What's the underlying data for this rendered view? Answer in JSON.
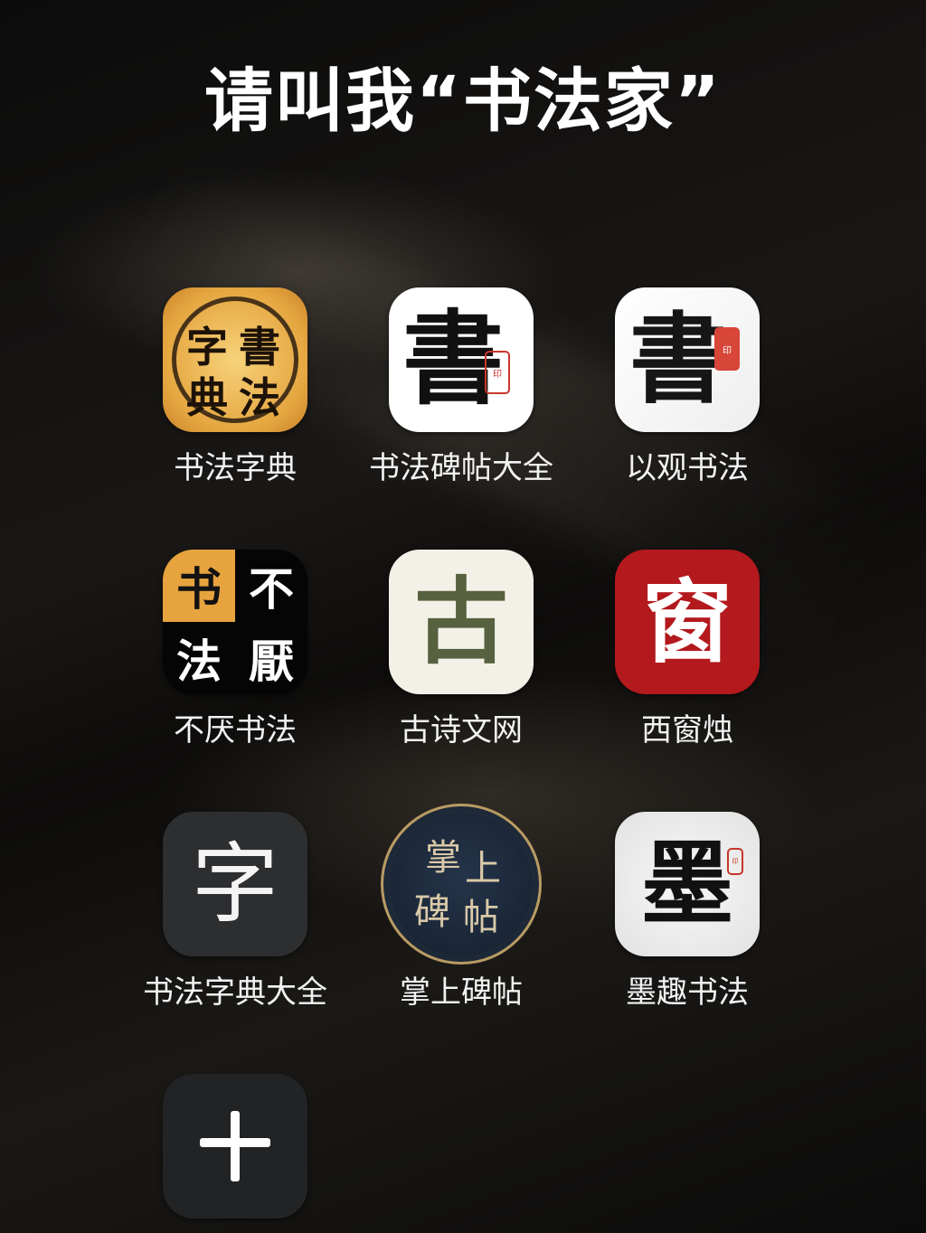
{
  "page": {
    "title": "请叫我“书法家”"
  },
  "apps": [
    {
      "label": "书法字典",
      "icon": "zidian-icon",
      "glyphs": [
        "字",
        "書",
        "典",
        "法"
      ]
    },
    {
      "label": "书法碑帖大全",
      "icon": "beitie-icon",
      "glyphs": [
        "書"
      ]
    },
    {
      "label": "以观书法",
      "icon": "yiguan-icon",
      "glyphs": [
        "書"
      ]
    },
    {
      "label": "不厌书法",
      "icon": "buyan-icon",
      "glyphs": [
        "书",
        "不",
        "法",
        "厭"
      ]
    },
    {
      "label": "古诗文网",
      "icon": "gushi-icon",
      "glyphs": [
        "古"
      ]
    },
    {
      "label": "西窗烛",
      "icon": "xichuang-icon",
      "glyphs": [
        "窗"
      ]
    },
    {
      "label": "书法字典大全",
      "icon": "zidian-daquan-icon",
      "glyphs": [
        "字"
      ]
    },
    {
      "label": "掌上碑帖",
      "icon": "zhangshang-icon",
      "glyphs": [
        "掌",
        "上",
        "碑",
        "帖"
      ]
    },
    {
      "label": "墨趣书法",
      "icon": "moqu-icon",
      "glyphs": [
        "墨"
      ]
    }
  ],
  "add_tile": {
    "icon": "plus-icon",
    "glyph": "+"
  },
  "colors": {
    "background": "#090909",
    "text": "#ffffff",
    "seal_red": "#c8362c",
    "xichuang_red": "#b3191d",
    "zidian_gold": "#e5a640"
  }
}
